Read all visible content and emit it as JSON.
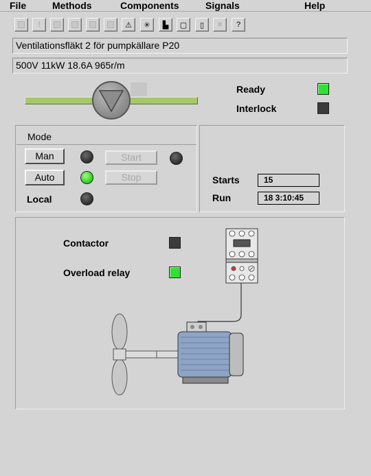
{
  "menu": [
    "File",
    "Methods",
    "Components",
    "Signals",
    "Help"
  ],
  "toolbar": {
    "buttons": [
      {
        "icon": "blank-icon",
        "glyph": "",
        "enabled": false
      },
      {
        "icon": "exclamation-icon",
        "glyph": "!",
        "enabled": false
      },
      {
        "icon": "blank-icon",
        "glyph": "",
        "enabled": false
      },
      {
        "icon": "blank-icon",
        "glyph": "",
        "enabled": false
      },
      {
        "icon": "blank-icon",
        "glyph": "",
        "enabled": false
      },
      {
        "icon": "blank-icon",
        "glyph": "",
        "enabled": false
      },
      {
        "icon": "warning-icon",
        "glyph": "⚠",
        "enabled": true
      },
      {
        "icon": "star-icon",
        "glyph": "✳",
        "enabled": true
      },
      {
        "icon": "blocks-icon",
        "glyph": "▙",
        "enabled": true
      },
      {
        "icon": "square-icon",
        "glyph": "▢",
        "enabled": true
      },
      {
        "icon": "document-icon",
        "glyph": "▯",
        "enabled": true
      },
      {
        "icon": "list-icon",
        "glyph": "≡",
        "enabled": false
      },
      {
        "icon": "help-icon",
        "glyph": "?",
        "enabled": true
      }
    ]
  },
  "object": {
    "description": "Ventilationsfläkt 2 för pumpkällare P20",
    "specification": "500V 11kW 18.6A 965r/m"
  },
  "status": {
    "ready_label": "Ready",
    "interlock_label": "Interlock",
    "ready_state": "on",
    "interlock_state": "off"
  },
  "mode_panel": {
    "title": "Mode",
    "man_label": "Man",
    "auto_label": "Auto",
    "local_label": "Local",
    "start_label": "Start",
    "stop_label": "Stop",
    "man_state": "off",
    "auto_state": "on",
    "local_state": "off",
    "start_state": "off"
  },
  "counters": {
    "starts_label": "Starts",
    "starts_value": "15",
    "run_label": "Run",
    "run_value": "18 3:10:45"
  },
  "components": {
    "contactor_label": "Contactor",
    "contactor_state": "off",
    "overload_label": "Overload relay",
    "overload_state": "on"
  },
  "colors": {
    "indicator_on": "#33e033",
    "indicator_off": "#3c3c3c",
    "motor_blue": "#8ea4c6",
    "background": "#d4d4d4"
  }
}
